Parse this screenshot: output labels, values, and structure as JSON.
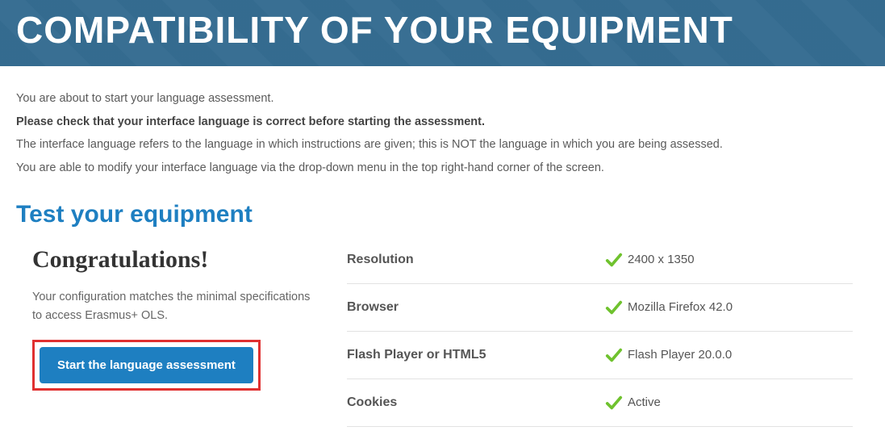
{
  "hero": {
    "title": "COMPATIBILITY OF YOUR EQUIPMENT"
  },
  "intro": {
    "line1": "You are about to start your language assessment.",
    "line2_bold": "Please check that your interface language is correct before starting the assessment.",
    "line3": "The interface language refers to the language in which instructions are given; this is NOT the language in which you are being assessed.",
    "line4": "You are able to modify your interface language via the drop-down menu in the top right-hand corner of the screen."
  },
  "subhead": "Test your equipment",
  "congrats": {
    "title": "Congratulations!",
    "body": "Your configuration matches the minimal specifications to access Erasmus+ OLS.",
    "button_label": "Start the language assessment"
  },
  "checks": [
    {
      "label": "Resolution",
      "value": "2400 x 1350",
      "status": "ok"
    },
    {
      "label": "Browser",
      "value": "Mozilla Firefox 42.0",
      "status": "ok"
    },
    {
      "label": "Flash Player or HTML5",
      "value": "Flash Player 20.0.0",
      "status": "ok"
    },
    {
      "label": "Cookies",
      "value": "Active",
      "status": "ok"
    }
  ],
  "colors": {
    "accent": "#1e7fc1",
    "highlight_border": "#e03030",
    "check_ok": "#6fc22e"
  }
}
